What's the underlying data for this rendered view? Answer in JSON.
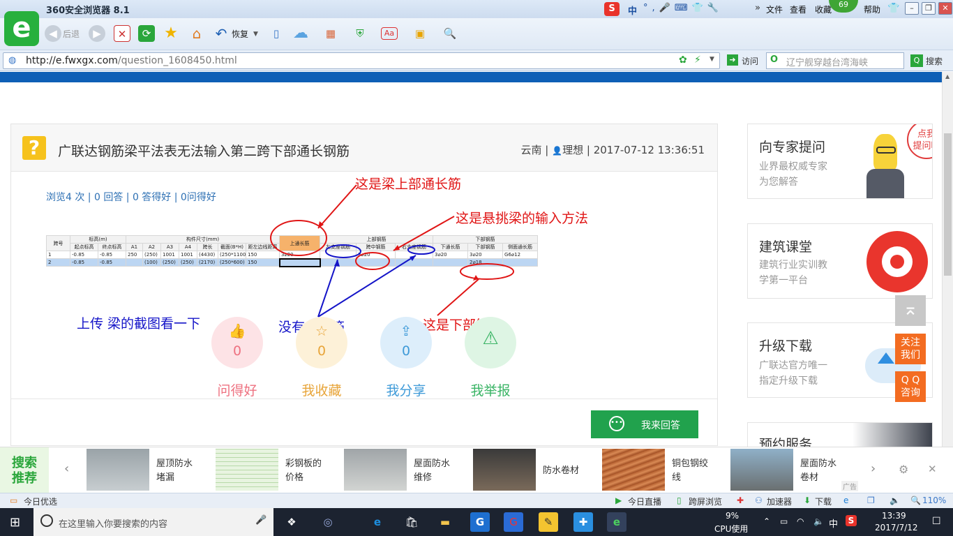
{
  "browser": {
    "title": "360安全浏览器 8.1",
    "badge": "69",
    "menu": [
      "文件",
      "查看",
      "收藏",
      "帮助"
    ],
    "back_label": "后退",
    "restore_label": "恢复",
    "url_host": "http://e.fwxgx.com",
    "url_path": "/question_1608450.html",
    "visit_label": "访问",
    "search_placeholder": "辽宁舰穿越台湾海峡",
    "search_button": "搜索",
    "ime_label": "中"
  },
  "question": {
    "title": "广联达钢筋梁平法表无法输入第二跨下部通长钢筋",
    "region": "云南",
    "user": "理想",
    "datetime": "2017-07-12 13:36:51",
    "stats": "浏览4 次 | 0 回答 | 0 答得好 | 0问得好"
  },
  "sheet": {
    "group_headers": [
      "标高(m)",
      "构件尺寸(mm)",
      "上通长筋",
      "上部钢筋",
      "下部钢筋"
    ],
    "headers": [
      "跨号",
      "起点标高",
      "终点标高",
      "A1",
      "A2",
      "A3",
      "A4",
      "跨长",
      "截面(B*H)",
      "距左边线距离",
      "",
      "左支座钢筋",
      "跨中钢筋",
      "右支座钢筋",
      "下通长筋",
      "下部钢筋",
      "侧面通长筋"
    ],
    "rows": [
      [
        "1",
        "-0.85",
        "-0.85",
        "250",
        "(250)",
        "1001",
        "1001",
        "(4430)",
        "(250*1100)",
        "150",
        "3⌀20",
        "",
        "3⌀20",
        "",
        "3⌀20",
        "3⌀20",
        "G6⌀12"
      ],
      [
        "2",
        "-0.85",
        "-0.85",
        "",
        "(100)",
        "(250)",
        "(250)",
        "(2170)",
        "(250*600)",
        "150",
        "",
        "",
        "",
        "",
        "",
        "2⌀18",
        ""
      ]
    ]
  },
  "annotations": {
    "top_rebar": "这是梁上部通长筋",
    "cantilever": "这是悬挑梁的输入方法",
    "upload": "上传  梁的截图看一下",
    "no_support": "没有支座筋",
    "bottom": "这是下部筋"
  },
  "actions": [
    {
      "label": "问得好",
      "count": "0",
      "icon": "thumbs-up"
    },
    {
      "label": "我收藏",
      "count": "0",
      "icon": "star"
    },
    {
      "label": "我分享",
      "count": "0",
      "icon": "share"
    },
    {
      "label": "我举报",
      "count": "",
      "icon": "warning"
    }
  ],
  "answer_button": "我来回答",
  "sidebar": [
    {
      "title": "向专家提问",
      "sub1": "业界最权威专家",
      "sub2": "为您解答",
      "bubble": "点我\n提问哦"
    },
    {
      "title": "建筑课堂",
      "sub1": "建筑行业实训教",
      "sub2": "学第一平台"
    },
    {
      "title": "升级下载",
      "sub1": "广联达官方唯一",
      "sub2": "指定升级下载"
    },
    {
      "title": "预约服务"
    }
  ],
  "floating": {
    "follow": "关注\n我们",
    "qq": "Q Q\n咨询"
  },
  "recommend": {
    "label": "搜索\n推荐",
    "items": [
      "屋顶防水\n堵漏",
      "彩钢板的\n价格",
      "屋面防水\n维修",
      "防水卷材",
      "铜包钢绞\n线",
      "屋面防水\n卷材"
    ],
    "ad": "广告"
  },
  "statusbar": {
    "left": "今日优选",
    "live": "今日直播",
    "cross": "跨屏浏览",
    "accel": "加速器",
    "download": "下载",
    "zoom": "110%"
  },
  "taskbar": {
    "search_placeholder": "在这里输入你要搜索的内容",
    "cpu_pct": "9%",
    "cpu_label": "CPU使用",
    "ime": "中",
    "time": "13:39",
    "date": "2017/7/12"
  },
  "colors": {
    "brand_green": "#27b03d",
    "annotation_red": "#e01515",
    "annotation_blue": "#1414c8",
    "answer_green": "#21a24d",
    "orange": "#f36c21"
  }
}
